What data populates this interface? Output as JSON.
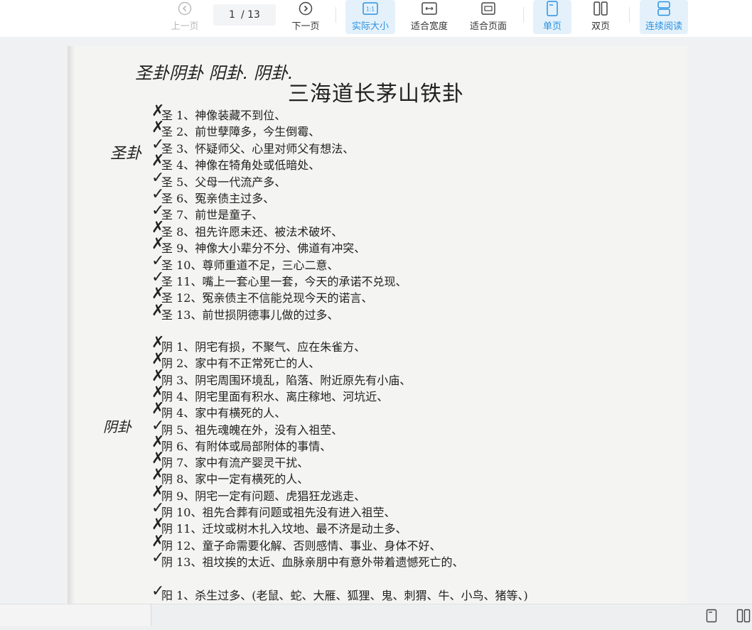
{
  "toolbar": {
    "prev_label": "上一页",
    "next_label": "下一页",
    "page_current": "1",
    "page_total": "/ 13",
    "actual_size_label": "实际大小",
    "fit_width_label": "适合宽度",
    "fit_page_label": "适合页面",
    "single_page_label": "单页",
    "double_page_label": "双页",
    "continuous_label": "连续阅读",
    "actual_size_icon_text": "1:1"
  },
  "document": {
    "title": "三海道长茅山铁卦",
    "handwriting_top": "圣卦阴卦 阳卦.  阴卦.",
    "handwriting_left_1": "圣卦",
    "handwriting_left_2": "阴卦",
    "items": [
      {
        "mark": "✗",
        "text": "圣 1、神像装藏不到位、"
      },
      {
        "mark": "✗",
        "text": "圣 2、前世孽障多，今生倒霉、"
      },
      {
        "mark": "✓",
        "text": "圣 3、怀疑师父、心里对师父有想法、"
      },
      {
        "mark": "✗",
        "text": "圣 4、神像在犄角处或低暗处、"
      },
      {
        "mark": "✓",
        "text": "圣 5、父母一代流产多、"
      },
      {
        "mark": "✓",
        "text": "圣 6、冤亲债主过多、"
      },
      {
        "mark": "✓",
        "text": "圣 7、前世是童子、"
      },
      {
        "mark": "✗",
        "text": "圣 8、祖先许愿未还、被法术破坏、"
      },
      {
        "mark": "✗",
        "text": "圣 9、神像大小辈分不分、佛道有冲突、"
      },
      {
        "mark": "✓",
        "text": "圣 10、尊师重道不足，三心二意、"
      },
      {
        "mark": "✓",
        "text": "圣 11、嘴上一套心里一套，今天的承诺不兑现、"
      },
      {
        "mark": "✗",
        "text": "圣 12、冤亲债主不信能兑现今天的诺言、"
      },
      {
        "mark": "✗",
        "text": "圣 13、前世损阴德事儿做的过多、"
      },
      {
        "mark": "✗",
        "text": "阴 1、阴宅有损，不聚气、应在朱雀方、"
      },
      {
        "mark": "✗",
        "text": "阴 2、家中有不正常死亡的人、"
      },
      {
        "mark": "✗",
        "text": "阴 3、阴宅周围环境乱，陷落、附近原先有小庙、"
      },
      {
        "mark": "✗",
        "text": "阴 4、阴宅里面有积水、离庄稼地、河坑近、"
      },
      {
        "mark": "✗",
        "text": "阴 4、家中有横死的人、"
      },
      {
        "mark": "✓",
        "text": "阴 5、祖先魂魄在外，没有入祖茔、"
      },
      {
        "mark": "✗",
        "text": "阴 6、有附体或局部附体的事情、"
      },
      {
        "mark": "✗",
        "text": "阴 7、家中有流产婴灵干扰、"
      },
      {
        "mark": "✗",
        "text": "阴 8、家中一定有横死的人、"
      },
      {
        "mark": "✗",
        "text": "阴 9、阴宅一定有问题、虎猖狂龙逃走、"
      },
      {
        "mark": "✓",
        "text": "阴 10、祖先合葬有问题或祖先没有进入祖茔、"
      },
      {
        "mark": "✗",
        "text": "阴 11、迁坟或树木扎入坟地、最不济是动土多、"
      },
      {
        "mark": "✗",
        "text": "阴 12、童子命需要化解、否则感情、事业、身体不好、"
      },
      {
        "mark": "✓",
        "text": "阴 13、祖坟挨的太近、血脉亲朋中有意外带着遗憾死亡的、"
      },
      {
        "mark": "✓",
        "text": "阳 1、杀生过多、(老鼠、蛇、大雁、狐狸、鬼、刺猬、牛、小鸟、猪等、)"
      }
    ]
  },
  "icons": {
    "prev": "chevron-left-circle-icon",
    "next": "chevron-right-circle-icon",
    "accent": "#2a93e0"
  }
}
